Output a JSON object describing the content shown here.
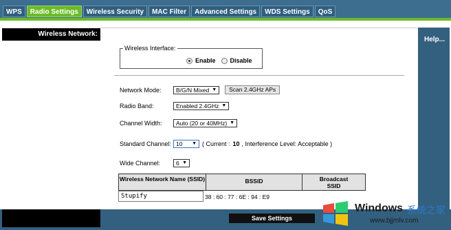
{
  "tabs": [
    {
      "label": "WPS",
      "active": false
    },
    {
      "label": "Radio Settings",
      "active": true
    },
    {
      "label": "Wireless Security",
      "active": false
    },
    {
      "label": "MAC Filter",
      "active": false
    },
    {
      "label": "Advanced Settings",
      "active": false
    },
    {
      "label": "WDS Settings",
      "active": false
    },
    {
      "label": "QoS",
      "active": false
    }
  ],
  "sidebar": {
    "title": "Wireless Network:"
  },
  "help": {
    "label": "Help..."
  },
  "wireless_interface": {
    "legend": "Wireless Interface:",
    "enable_label": "Enable",
    "disable_label": "Disable",
    "selected": "Enable"
  },
  "form": {
    "network_mode": {
      "label": "Network Mode:",
      "value": "B/G/N Mixed",
      "scan_button": "Scan 2.4GHz APs"
    },
    "radio_band": {
      "label": "Radio Band:",
      "value": "Enabled 2.4GHz"
    },
    "channel_width": {
      "label": "Channel Width:",
      "value": "Auto (20 or 40MHz)"
    },
    "standard_channel": {
      "label": "Standard Channel:",
      "value": "10",
      "info_prefix": "( Current :",
      "current": "10",
      "info_suffix": ", Interference Level: Acceptable )"
    },
    "wide_channel": {
      "label": "Wide Channel:",
      "value": "6"
    }
  },
  "table": {
    "headers": {
      "ssid": "Wireless Network Name (SSID)",
      "bssid": "BSSID",
      "broadcast": "Broadcast SSID"
    },
    "row": {
      "ssid": "Stupify",
      "bssid": "38 : 60 : 77 : 6E : 94 : E9"
    }
  },
  "footer": {
    "save_label": "Save Settings"
  },
  "watermark": {
    "brand": "Windows",
    "cn": "系统之家",
    "url": "www.bjjmlv.com"
  },
  "colors": {
    "tab_bar": "#3d6d8f",
    "active_tab": "#6cbb2a",
    "panel": "#34607f"
  }
}
